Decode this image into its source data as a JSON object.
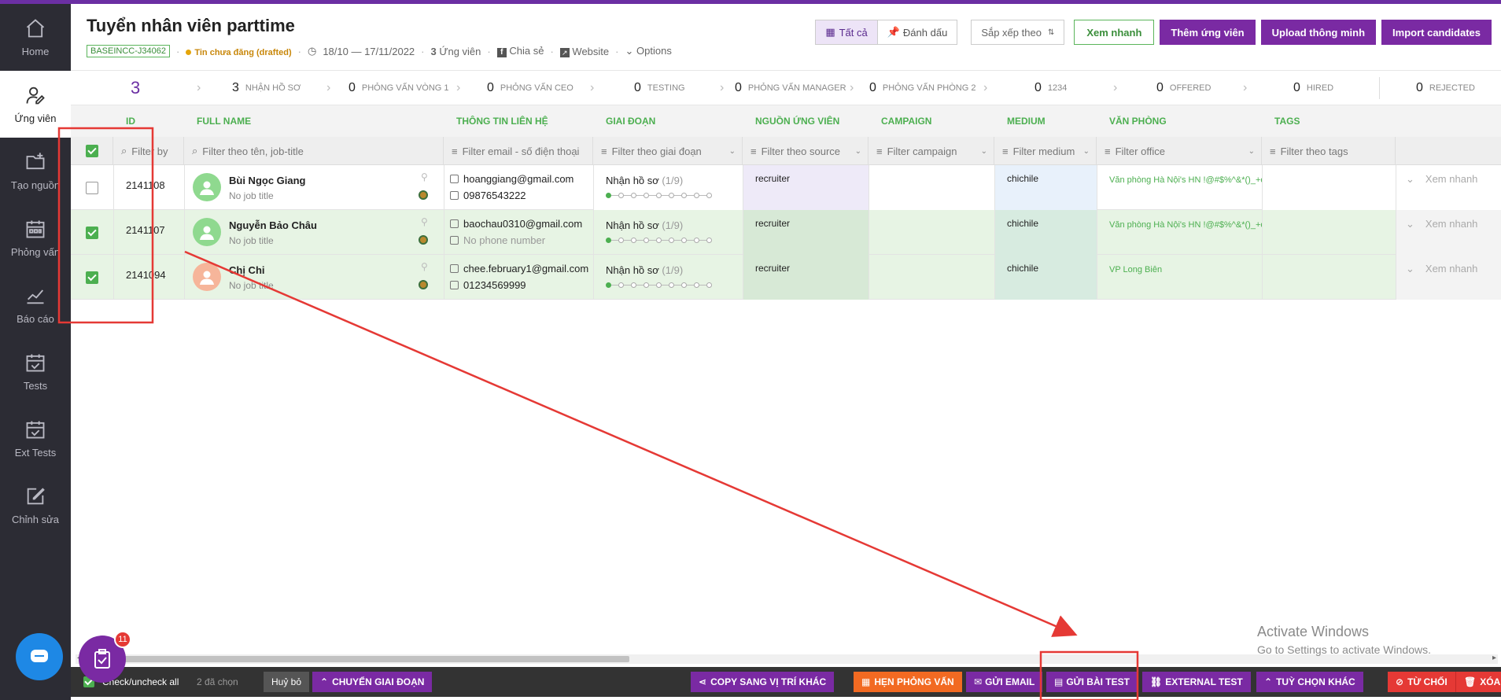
{
  "sidebar": {
    "items": [
      {
        "label": "Home",
        "icon": "home-icon"
      },
      {
        "label": "Ứng viên",
        "icon": "user-edit-icon"
      },
      {
        "label": "Tạo nguồn",
        "icon": "folder-plus-icon"
      },
      {
        "label": "Phỏng vấn",
        "icon": "calendar-icon"
      },
      {
        "label": "Báo cáo",
        "icon": "chart-line-icon"
      },
      {
        "label": "Tests",
        "icon": "calendar-check-icon"
      },
      {
        "label": "Ext Tests",
        "icon": "calendar-check-icon"
      },
      {
        "label": "Chỉnh sửa",
        "icon": "edit-icon"
      }
    ]
  },
  "header": {
    "title": "Tuyển nhân viên parttime",
    "code": "BASEINCC-J34062",
    "status": "Tin chưa đăng (drafted)",
    "date_range": "18/10 — 17/11/2022",
    "candidates_count": "3",
    "candidates_label": "Ứng viên",
    "share": "Chia sẻ",
    "website": "Website",
    "options": "Options",
    "filter_all": "Tất cả",
    "filter_marked": "Đánh dấu",
    "sort_label": "Sắp xếp theo",
    "quick_view": "Xem nhanh",
    "add_candidate": "Thêm ứng viên",
    "smart_upload": "Upload thông minh",
    "import": "Import candidates"
  },
  "pipeline": [
    {
      "count": "3",
      "label": ""
    },
    {
      "count": "3",
      "label": "NHẬN HỒ SƠ"
    },
    {
      "count": "0",
      "label": "PHỎNG VẤN VÒNG 1"
    },
    {
      "count": "0",
      "label": "PHỎNG VẤN CEO"
    },
    {
      "count": "0",
      "label": "TESTING"
    },
    {
      "count": "0",
      "label": "PHỎNG VẤN MANAGER"
    },
    {
      "count": "0",
      "label": "PHỎNG VẤN PHÒNG 2"
    },
    {
      "count": "0",
      "label": "1234"
    },
    {
      "count": "0",
      "label": "OFFERED"
    },
    {
      "count": "0",
      "label": "HIRED"
    },
    {
      "count": "0",
      "label": "REJECTED"
    }
  ],
  "columns": [
    "ID",
    "FULL NAME",
    "THÔNG TIN LIÊN HỆ",
    "GIAI ĐOẠN",
    "NGUỒN ỨNG VIÊN",
    "CAMPAIGN",
    "MEDIUM",
    "VĂN PHÒNG",
    "TAGS"
  ],
  "filters": {
    "id": "Filter by",
    "name": "Filter theo tên, job-title",
    "contact": "Filter email - số điện thoại",
    "stage": "Filter theo giai đoạn",
    "source": "Filter theo source",
    "campaign": "Filter campaign",
    "medium": "Filter medium",
    "office": "Filter office",
    "tags": "Filter theo tags"
  },
  "rows": [
    {
      "id": "2141108",
      "name": "Bùi Ngọc Giang",
      "job": "No job title",
      "email": "hoanggiang@gmail.com",
      "phone": "09876543222",
      "stage": "Nhận hồ sơ",
      "stage_step": "(1/9)",
      "source": "recruiter",
      "medium": "chichile",
      "office": "Văn phòng Hà Nội's HN !@#$%^&*()_+o}",
      "quick": "Xem nhanh",
      "checked": false
    },
    {
      "id": "2141107",
      "name": "Nguyễn Bảo Châu",
      "job": "No job title",
      "email": "baochau0310@gmail.com",
      "phone": "No phone number",
      "stage": "Nhận hồ sơ",
      "stage_step": "(1/9)",
      "source": "recruiter",
      "medium": "chichile",
      "office": "Văn phòng Hà Nội's HN !@#$%^&*()_+o}",
      "quick": "Xem nhanh",
      "checked": true
    },
    {
      "id": "2141094",
      "name": "Chị Chi",
      "job": "No job title",
      "email": "chee.february1@gmail.com",
      "phone": "01234569999",
      "stage": "Nhận hồ sơ",
      "stage_step": "(1/9)",
      "source": "recruiter",
      "medium": "chichile",
      "office": "VP Long Biên",
      "quick": "Xem nhanh",
      "checked": true
    }
  ],
  "bottom": {
    "check_all": "Check/uncheck all",
    "selected": "2 đã chọn",
    "cancel": "Huỷ bỏ",
    "move_stage": "CHUYỂN GIAI ĐOẠN",
    "copy": "COPY SANG VỊ TRÍ KHÁC",
    "interview": "HẸN PHỎNG VẤN",
    "email": "GỬI EMAIL",
    "send_test": "GỬI BÀI TEST",
    "external_test": "EXTERNAL TEST",
    "more": "TUỲ CHỌN KHÁC",
    "reject": "TỪ CHỐI",
    "delete": "XÓA"
  },
  "watermark": {
    "line1": "Activate Windows",
    "line2": "Go to Settings to activate Windows."
  },
  "task_badge": "11",
  "colors": {
    "accent": "#7a2aa3",
    "green": "#4caf50",
    "sidebar": "#2c2c34",
    "annotation": "#e53935"
  }
}
